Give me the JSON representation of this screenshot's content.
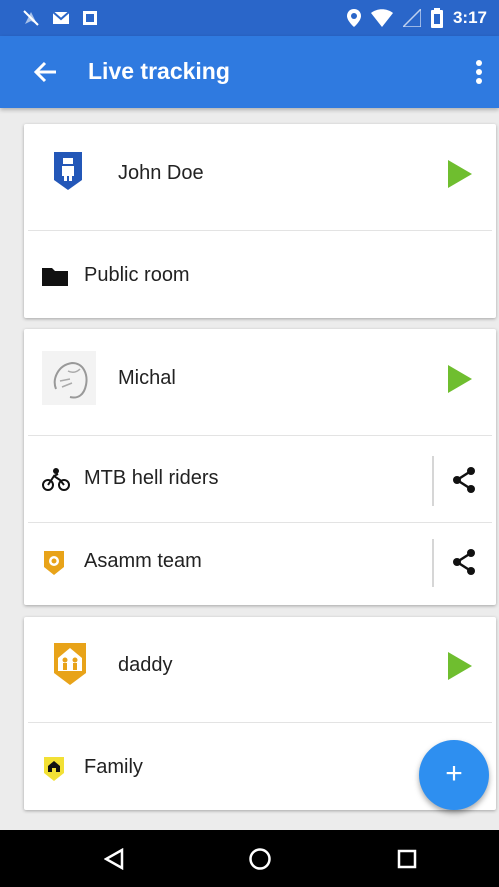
{
  "status_bar": {
    "time": "3:17",
    "icons": [
      "location-off-icon",
      "mail-icon",
      "photo-icon",
      "location-pin-icon",
      "wifi-icon",
      "signal-icon",
      "battery-icon"
    ]
  },
  "app_bar": {
    "title": "Live tracking",
    "back_icon": "arrow-back-icon",
    "menu_icon": "more-vert-icon"
  },
  "cards": [
    {
      "user": {
        "name": "John Doe",
        "avatar": "person-badge-icon",
        "action_icon": "play-icon"
      },
      "rooms": [
        {
          "label": "Public room",
          "icon": "folder-icon"
        }
      ]
    },
    {
      "user": {
        "name": "Michal",
        "avatar": "photo-avatar",
        "action_icon": "play-icon"
      },
      "rooms": [
        {
          "label": "MTB hell riders",
          "icon": "biker-icon",
          "action_icon": "share-icon"
        },
        {
          "label": "Asamm team",
          "icon": "team-shield-icon",
          "action_icon": "share-icon"
        }
      ]
    },
    {
      "user": {
        "name": "daddy",
        "avatar": "family-shield-icon",
        "action_icon": "play-icon"
      },
      "rooms": [
        {
          "label": "Family",
          "icon": "home-shield-icon"
        }
      ]
    }
  ],
  "fab": {
    "label": "+",
    "icon": "add-icon"
  },
  "nav_bar": {
    "icons": [
      "back-triangle-icon",
      "home-circle-icon",
      "recents-square-icon"
    ]
  },
  "colors": {
    "primary": "#2f7ae0",
    "status_bar": "#2a66c9",
    "play": "#6fbe2f",
    "fab": "#2e8ff0"
  }
}
